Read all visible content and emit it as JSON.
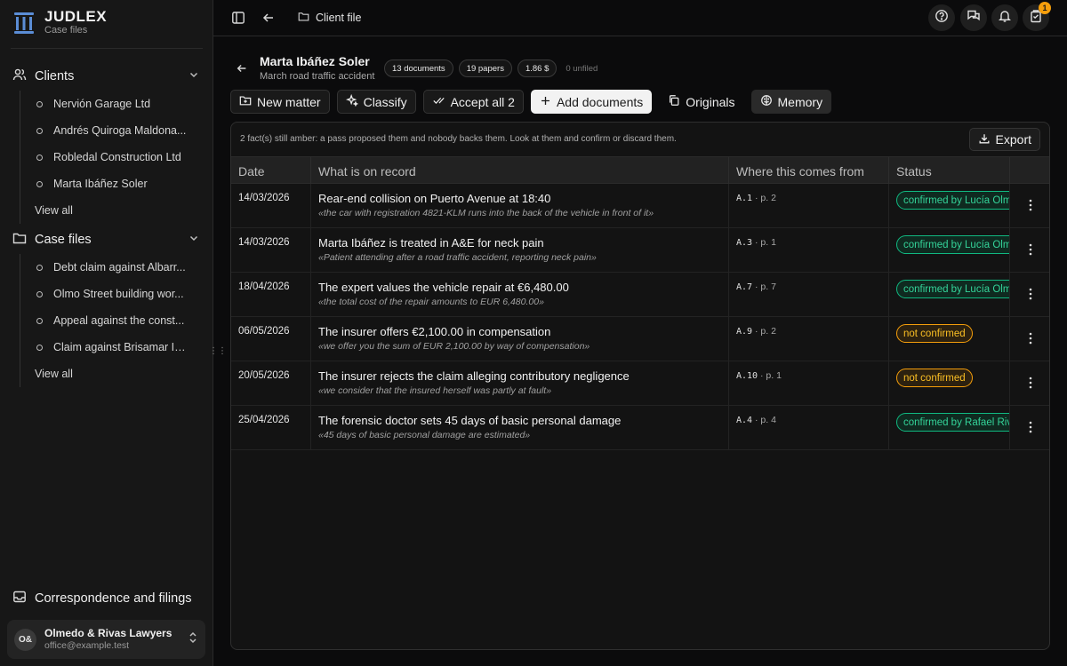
{
  "brand": {
    "title": "JUDLEX",
    "subtitle": "Case files"
  },
  "sidebar": {
    "clients": {
      "label": "Clients",
      "items": [
        "Nervión Garage Ltd",
        "Andrés Quiroga Maldona...",
        "Robledal Construction Ltd",
        "Marta Ibáñez Soler"
      ],
      "view_all": "View all"
    },
    "case_files": {
      "label": "Case files",
      "items": [
        "Debt claim against Albarr...",
        "Olmo Street building wor...",
        "Appeal against the const...",
        "Claim against Brisamar In..."
      ],
      "view_all": "View all"
    },
    "footer_link": "Correspondence and filings",
    "account": {
      "initials": "O&",
      "name": "Olmedo & Rivas Lawyers",
      "email": "office@example.test"
    }
  },
  "topbar": {
    "breadcrumb": "Client file",
    "notification_count": "1"
  },
  "matter": {
    "name": "Marta Ibáñez Soler",
    "subtitle": "March road traffic accident",
    "pills": {
      "documents": "13 documents",
      "papers": "19 papers",
      "cost": "1.86 $",
      "unfiled": "0 unfiled"
    }
  },
  "toolbar": {
    "new_matter": "New matter",
    "classify": "Classify",
    "accept_all": "Accept all 2",
    "add_documents": "Add documents",
    "originals": "Originals",
    "memory": "Memory"
  },
  "panel": {
    "notice": "2 fact(s) still amber: a pass proposed them and nobody backs them. Look at them and confirm or discard them.",
    "export": "Export",
    "columns": {
      "date": "Date",
      "what": "What is on record",
      "source": "Where this comes from",
      "status": "Status"
    },
    "rows": [
      {
        "date": "14/03/2026",
        "title": "Rear-end collision on Puerto Avenue at 18:40",
        "quote": "«the car with registration 4821-KLM runs into the back of the vehicle in front of it»",
        "ref": "A.1",
        "page": "· p. 2",
        "status": "confirmed by Lucía Olmedo",
        "status_type": "ok"
      },
      {
        "date": "14/03/2026",
        "title": "Marta Ibáñez is treated in A&E for neck pain",
        "quote": "«Patient attending after a road traffic accident, reporting neck pain»",
        "ref": "A.3",
        "page": "· p. 1",
        "status": "confirmed by Lucía Olmedo",
        "status_type": "ok"
      },
      {
        "date": "18/04/2026",
        "title": "The expert values the vehicle repair at €6,480.00",
        "quote": "«the total cost of the repair amounts to EUR 6,480.00»",
        "ref": "A.7",
        "page": "· p. 7",
        "status": "confirmed by Lucía Olmedo",
        "status_type": "ok"
      },
      {
        "date": "06/05/2026",
        "title": "The insurer offers €2,100.00 in compensation",
        "quote": "«we offer you the sum of EUR 2,100.00 by way of compensation»",
        "ref": "A.9",
        "page": "· p. 2",
        "status": "not confirmed",
        "status_type": "warn"
      },
      {
        "date": "20/05/2026",
        "title": "The insurer rejects the claim alleging contributory negligence",
        "quote": "«we consider that the insured herself was partly at fault»",
        "ref": "A.10",
        "page": "· p. 1",
        "status": "not confirmed",
        "status_type": "warn"
      },
      {
        "date": "25/04/2026",
        "title": "The forensic doctor sets 45 days of basic personal damage",
        "quote": "«45 days of basic personal damage are estimated»",
        "ref": "A.4",
        "page": "· p. 4",
        "status": "confirmed by Rafael Rivas",
        "status_type": "ok"
      }
    ]
  }
}
